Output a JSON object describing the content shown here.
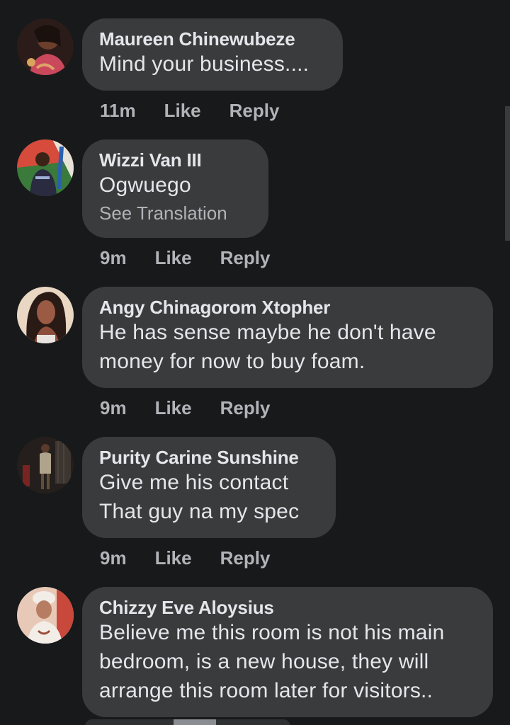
{
  "comments": [
    {
      "author": "Maureen Chinewubeze",
      "text": "Mind your business....",
      "time": "11m",
      "like": "Like",
      "reply": "Reply",
      "avatar_icon": "profile-photo-icon",
      "avatar_colors": [
        "#2b1c1a",
        "#c9485b",
        "#e0a16a"
      ]
    },
    {
      "author": "Wizzi Van III",
      "text": "Ogwuego",
      "see_translation": "See Translation",
      "time": "9m",
      "like": "Like",
      "reply": "Reply",
      "avatar_icon": "profile-photo-icon",
      "avatar_colors": [
        "#3a7a3a",
        "#d64b3b",
        "#2a2a40"
      ]
    },
    {
      "author": "Angy Chinagorom Xtopher",
      "text": "He has sense maybe he don't have money for now to buy foam.",
      "time": "9m",
      "like": "Like",
      "reply": "Reply",
      "avatar_icon": "profile-photo-icon",
      "avatar_colors": [
        "#e9d7c3",
        "#2a1a16",
        "#9b5a44"
      ]
    },
    {
      "author": "Purity Carine Sunshine",
      "text": "Give me his contact\nThat guy na my spec",
      "time": "9m",
      "like": "Like",
      "reply": "Reply",
      "avatar_icon": "profile-photo-icon",
      "avatar_colors": [
        "#241f1c",
        "#b0a38c",
        "#5e4f3d"
      ]
    },
    {
      "author": "Chizzy Eve Aloysius",
      "text": "Believe me this room is not his main bedroom, is a new house, they will arrange this room later for visitors..",
      "time": "",
      "like": "",
      "reply": "",
      "avatar_icon": "profile-photo-icon",
      "avatar_colors": [
        "#e8c9b8",
        "#f3ede8",
        "#9b4e3a"
      ]
    }
  ],
  "colors": {
    "background": "#18191a",
    "bubble": "#3a3b3c",
    "primary_text": "#e4e6eb",
    "secondary_text": "#b0b3b8"
  }
}
